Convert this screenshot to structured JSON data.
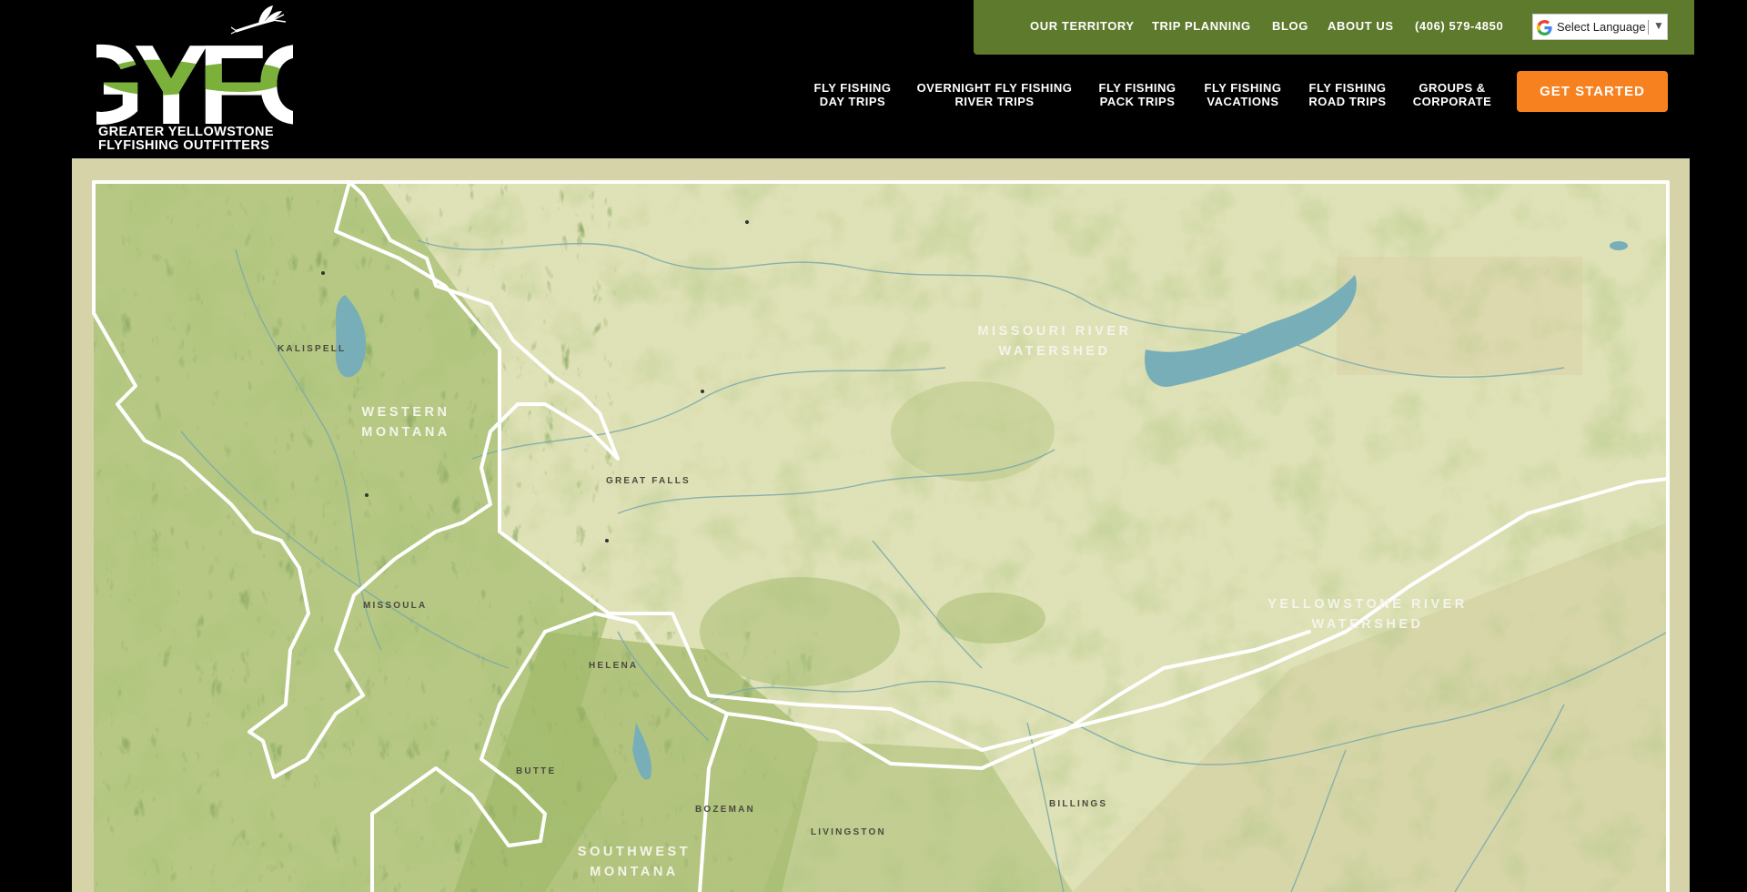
{
  "brand": {
    "logo_text": "GYFO",
    "tagline_line1": "GREATER YELLOWSTONE",
    "tagline_line2": "FLYFISHING OUTFITTERS"
  },
  "topnav": {
    "items": [
      {
        "label": "OUR TERRITORY"
      },
      {
        "label": "TRIP PLANNING"
      },
      {
        "label": "BLOG"
      },
      {
        "label": "ABOUT US"
      },
      {
        "label": "(406) 579-4850"
      }
    ],
    "language": {
      "label": "Select Language",
      "arrow": "▼",
      "icon": "google-g-icon"
    }
  },
  "mainnav": {
    "items": [
      {
        "label": "FLY FISHING\nDAY TRIPS"
      },
      {
        "label": "OVERNIGHT FLY FISHING\nRIVER TRIPS"
      },
      {
        "label": "FLY FISHING\nPACK TRIPS"
      },
      {
        "label": "FLY FISHING\nVACATIONS"
      },
      {
        "label": "FLY FISHING\nROAD TRIPS"
      },
      {
        "label": "GROUPS &\nCORPORATE"
      }
    ],
    "cta": "GET STARTED"
  },
  "map": {
    "regions": [
      {
        "line1": "WESTERN",
        "line2": "MONTANA"
      },
      {
        "line1": "MISSOURI RIVER",
        "line2": "WATERSHED"
      },
      {
        "line1": "YELLOWSTONE RIVER",
        "line2": "WATERSHED"
      },
      {
        "line1": "SOUTHWEST",
        "line2": "MONTANA"
      }
    ],
    "cities": [
      "KALISPELL",
      "GREAT FALLS",
      "MISSOULA",
      "HELENA",
      "BUTTE",
      "BOZEMAN",
      "LIVINGSTON",
      "BILLINGS"
    ]
  },
  "colors": {
    "header_bg": "#000000",
    "topbar_bg": "#5e7a2c",
    "cta_bg": "#f7811e",
    "logo_green": "#7bb13a",
    "map_base": "#e3e3bd",
    "mountain_green": "#93ad5a",
    "water": "#6aaab5",
    "border": "#ffffff"
  }
}
